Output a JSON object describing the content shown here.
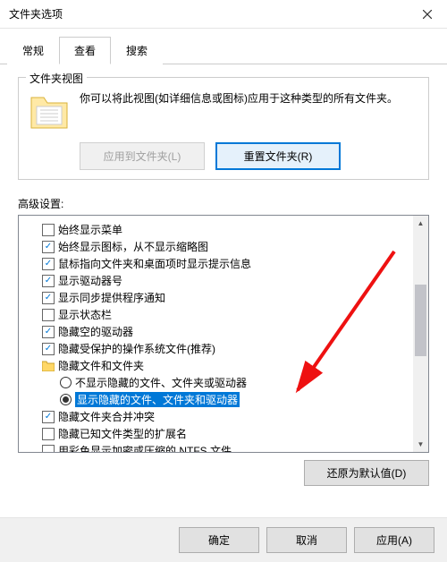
{
  "window": {
    "title": "文件夹选项"
  },
  "tabs": {
    "general": "常规",
    "view": "查看",
    "search": "搜索"
  },
  "folderViews": {
    "title": "文件夹视图",
    "desc": "你可以将此视图(如详细信息或图标)应用于这种类型的所有文件夹。",
    "applyBtn": "应用到文件夹(L)",
    "resetBtn": "重置文件夹(R)"
  },
  "advanced": {
    "label": "高级设置:",
    "items": [
      {
        "type": "check",
        "checked": false,
        "label": "始终显示菜单"
      },
      {
        "type": "check",
        "checked": true,
        "label": "始终显示图标，从不显示缩略图"
      },
      {
        "type": "check",
        "checked": true,
        "label": "鼠标指向文件夹和桌面项时显示提示信息"
      },
      {
        "type": "check",
        "checked": true,
        "label": "显示驱动器号"
      },
      {
        "type": "check",
        "checked": true,
        "label": "显示同步提供程序通知"
      },
      {
        "type": "check",
        "checked": false,
        "label": "显示状态栏"
      },
      {
        "type": "check",
        "checked": true,
        "label": "隐藏空的驱动器"
      },
      {
        "type": "check",
        "checked": true,
        "label": "隐藏受保护的操作系统文件(推荐)"
      },
      {
        "type": "folder",
        "label": "隐藏文件和文件夹"
      },
      {
        "type": "radio",
        "selected": false,
        "label": "不显示隐藏的文件、文件夹或驱动器"
      },
      {
        "type": "radio",
        "selected": true,
        "label": "显示隐藏的文件、文件夹和驱动器",
        "highlighted": true
      },
      {
        "type": "check",
        "checked": true,
        "label": "隐藏文件夹合并冲突"
      },
      {
        "type": "check",
        "checked": false,
        "label": "隐藏已知文件类型的扩展名"
      },
      {
        "type": "check",
        "checked": false,
        "label": "用彩色显示加密或压缩的 NTFS 文件"
      }
    ],
    "restoreBtn": "还原为默认值(D)"
  },
  "footer": {
    "ok": "确定",
    "cancel": "取消",
    "apply": "应用(A)"
  }
}
